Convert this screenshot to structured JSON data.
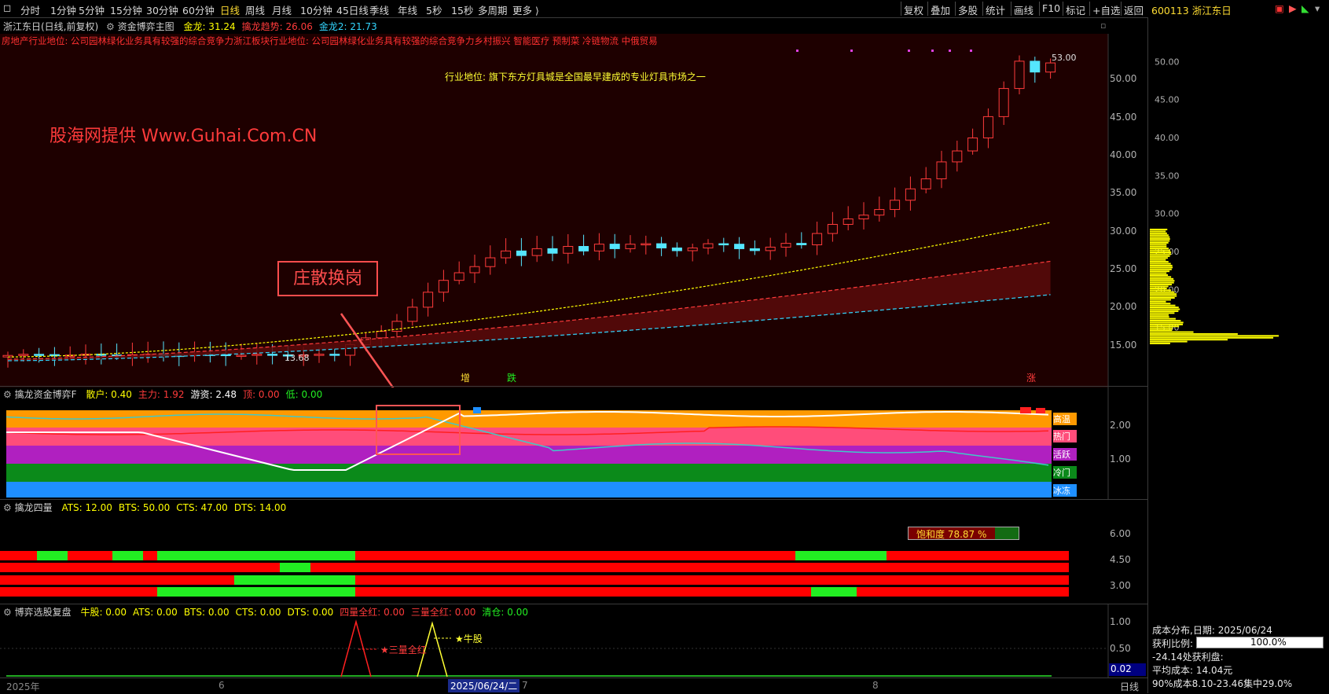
{
  "toolbar": {
    "periods": [
      "分时",
      "1分钟",
      "5分钟",
      "15分钟",
      "30分钟",
      "60分钟",
      "日线",
      "周线",
      "月线",
      "10分钟",
      "45日线",
      "季线",
      "年线",
      "5秒",
      "15秒",
      "多周期",
      "更多 ⟩"
    ],
    "active_period": "日线",
    "right_items": [
      "复权",
      "叠加",
      "多股",
      "统计",
      "画线",
      "F10",
      "标记",
      "+自选",
      "返回"
    ],
    "stock": "600113 浙江东日"
  },
  "main_chart": {
    "title": "浙江东日(日线,前复权)",
    "indicator": "资金博弈主图",
    "vals": [
      {
        "label": "金龙: 31.24",
        "color": "#ffff00"
      },
      {
        "label": "擒龙趋势: 26.06",
        "color": "#ff3b3b"
      },
      {
        "label": "金龙2: 21.73",
        "color": "#33d6ff"
      }
    ],
    "info_line": "房地产行业地位: 公司园林绿化业务具有较强的综合竞争力浙江板块行业地位: 公司园林绿化业务具有较强的综合竞争力乡村振兴 智能医疗 预制菜 冷链物流 中俄贸易",
    "industry": "行业地位: 旗下东方灯具城是全国最早建成的专业灯具市场之一",
    "watermark": "股海网提供 Www.Guhai.Com.CN",
    "annotation": "庄散换岗",
    "high_label": "53.00",
    "low_label": "13.68",
    "markers": [
      "增",
      "跌",
      "涨"
    ],
    "y_axis": [
      "50.00",
      "45.00",
      "40.00",
      "35.00",
      "30.00",
      "25.00",
      "20.00",
      "15.00"
    ]
  },
  "panel2": {
    "title": "擒龙资金博弈F",
    "vals": [
      {
        "label": "散户: 0.40",
        "color": "#ffff00"
      },
      {
        "label": "主力: 1.92",
        "color": "#ff3b3b"
      },
      {
        "label": "游资: 2.48",
        "color": "#ffffff"
      },
      {
        "label": "顶: 0.00",
        "color": "#ff3b3b"
      },
      {
        "label": "低: 0.00",
        "color": "#22ee22"
      }
    ],
    "zones": [
      "高温",
      "热门",
      "活跃",
      "冷门",
      "冰冻"
    ],
    "y_axis": [
      "2.00",
      "1.00"
    ]
  },
  "panel3": {
    "title": "擒龙四量",
    "vals": [
      {
        "label": "ATS: 12.00",
        "color": "#ffff00"
      },
      {
        "label": "BTS: 50.00",
        "color": "#ffff00"
      },
      {
        "label": "CTS: 47.00",
        "color": "#ffff00"
      },
      {
        "label": "DTS: 14.00",
        "color": "#ffff00"
      }
    ],
    "saturation": "饱和度 78.87 %",
    "y_axis": [
      "6.00",
      "4.50",
      "3.00"
    ]
  },
  "panel4": {
    "title": "博弈选股复盘",
    "vals": [
      {
        "label": "牛股: 0.00",
        "color": "#ffff00"
      },
      {
        "label": "ATS: 0.00",
        "color": "#ffff00"
      },
      {
        "label": "BTS: 0.00",
        "color": "#ffff00"
      },
      {
        "label": "CTS: 0.00",
        "color": "#ffff00"
      },
      {
        "label": "DTS: 0.00",
        "color": "#ffff00"
      },
      {
        "label": "四量全红: 0.00",
        "color": "#ff3b3b"
      },
      {
        "label": "三量全红: 0.00",
        "color": "#ff3b3b"
      },
      {
        "label": "清仓: 0.00",
        "color": "#22ee22"
      }
    ],
    "sig1": "★三量全红",
    "sig2": "★牛股",
    "y_axis": [
      "1.00",
      "0.50"
    ],
    "cursor_value": "0.02"
  },
  "x_axis": {
    "labels": [
      "2025年",
      "6",
      "7",
      "8"
    ],
    "cursor_date": "2025/06/24/二",
    "period": "日线"
  },
  "sidebar": {
    "title": "成本分布,日期:",
    "date": "2025/06/24",
    "profit_label": "获利比例:",
    "profit_value": "100.0%",
    "profit_price": "-24.14处获利盘:",
    "avg_cost": "平均成本: 14.04元",
    "concentration": "90%成本8.10-23.46集中29.0%",
    "y_axis": [
      "50.00",
      "45.00",
      "40.00",
      "35.00",
      "30.00",
      "25.00",
      "20.00",
      "15.00"
    ]
  },
  "colors": {
    "up": "#ff3b3b",
    "down": "#55e6ff",
    "yellow": "#ffff00",
    "bg_main": "#1e0000"
  }
}
